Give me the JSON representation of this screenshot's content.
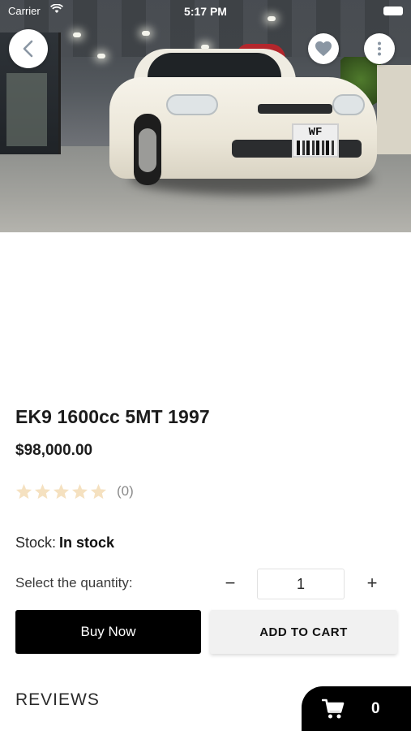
{
  "status_bar": {
    "carrier": "Carrier",
    "time": "5:17 PM"
  },
  "top_actions": {
    "back_icon": "chevron-left-icon",
    "favorite_icon": "heart-icon",
    "more_icon": "more-vertical-icon"
  },
  "product": {
    "title": "EK9 1600cc 5MT 1997",
    "price": "$98,000.00",
    "rating": {
      "stars": 0,
      "max_stars": 5,
      "count_text": "(0)",
      "star_color": "#f5e1c0"
    },
    "stock_label": "Stock:",
    "stock_value": "In stock",
    "plate_text": "WF"
  },
  "quantity": {
    "label": "Select the quantity:",
    "minus": "−",
    "value": "1",
    "plus": "+"
  },
  "actions": {
    "buy_now": "Buy Now",
    "add_to_cart": "ADD TO CART"
  },
  "reviews": {
    "heading": "REVIEWS"
  },
  "cart": {
    "icon": "shopping-cart-icon",
    "count": "0"
  },
  "colors": {
    "primary": "#000000",
    "secondary_button": "#f1f1f1",
    "icon_gray": "#8a96a3"
  }
}
